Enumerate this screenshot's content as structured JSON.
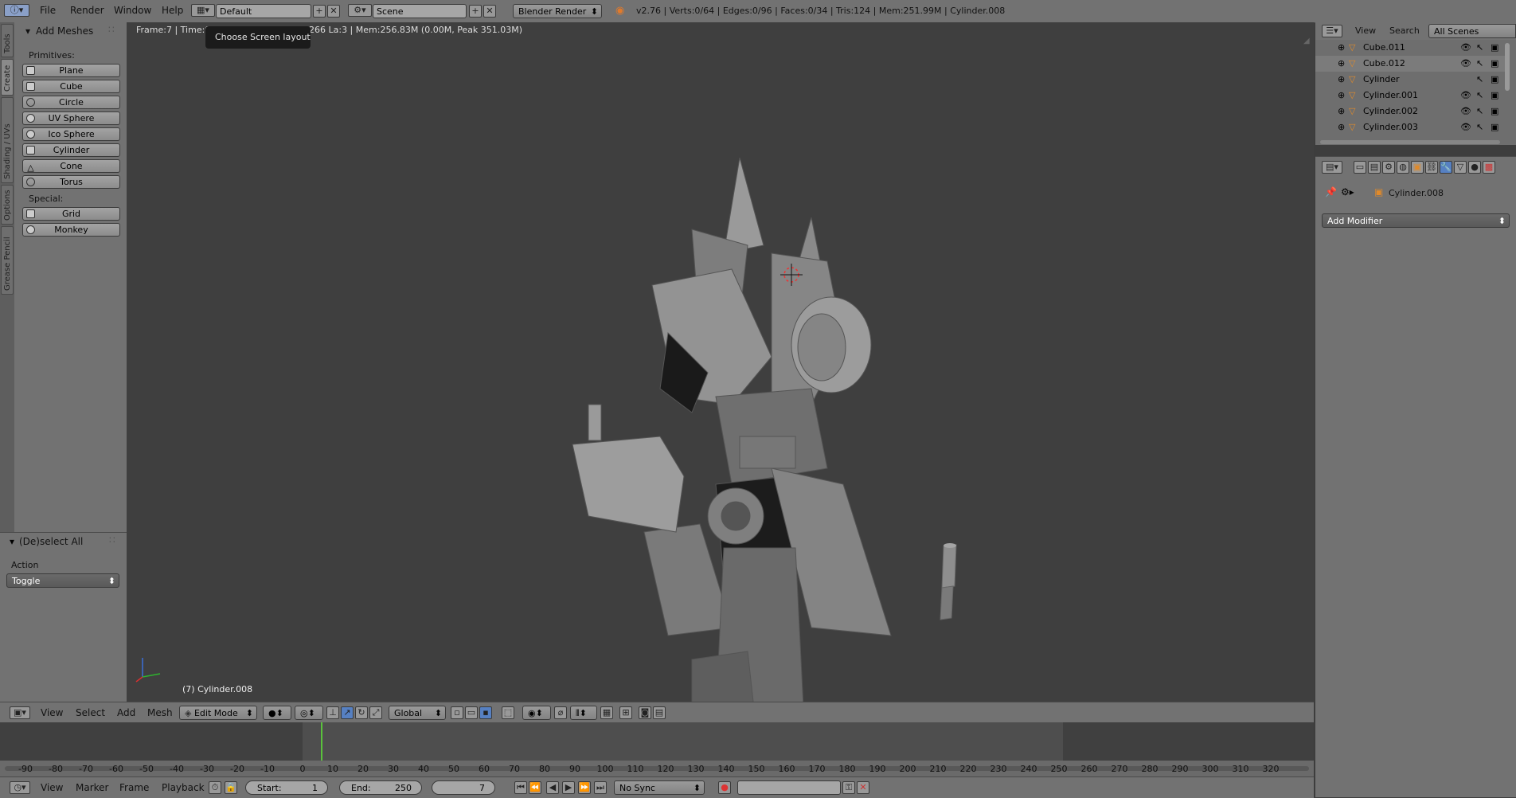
{
  "topbar": {
    "menus": [
      "File",
      "Render",
      "Window",
      "Help"
    ],
    "layout_name": "Default",
    "scene_name": "Scene",
    "engine": "Blender Render",
    "stats": "v2.76 | Verts:0/64 | Edges:0/96 | Faces:0/34 | Tris:124 | Mem:251.99M | Cylinder.008"
  },
  "tooltip": "Choose Screen layout",
  "viewport": {
    "info": "Frame:7 | Time:00",
    "info2": "2266 La:3 | Mem:256.83M (0.00M, Peak 351.03M)",
    "object_label": "(7) Cylinder.008"
  },
  "tabs": [
    "Tools",
    "Create",
    "Shading / UVs",
    "Options",
    "Grease Pencil"
  ],
  "add_meshes": {
    "title": "Add Meshes",
    "primitives_label": "Primitives:",
    "primitives": [
      "Plane",
      "Cube",
      "Circle",
      "UV Sphere",
      "Ico Sphere",
      "Cylinder",
      "Cone",
      "Torus"
    ],
    "special_label": "Special:",
    "special": [
      "Grid",
      "Monkey"
    ]
  },
  "redo": {
    "title": "(De)select All",
    "action_label": "Action",
    "action_value": "Toggle"
  },
  "vheader": {
    "menus": [
      "View",
      "Select",
      "Add",
      "Mesh"
    ],
    "mode": "Edit Mode",
    "orientation": "Global"
  },
  "timeline": {
    "ticks": [
      "-90",
      "-80",
      "-70",
      "-60",
      "-50",
      "-40",
      "-30",
      "-20",
      "-10",
      "0",
      "10",
      "20",
      "30",
      "40",
      "50",
      "60",
      "70",
      "80",
      "90",
      "100",
      "110",
      "120",
      "130",
      "140",
      "150",
      "160",
      "170",
      "180",
      "190",
      "200",
      "210",
      "220",
      "230",
      "240",
      "250",
      "260",
      "270",
      "280",
      "290",
      "300",
      "310",
      "320"
    ],
    "menus": [
      "View",
      "Marker",
      "Frame",
      "Playback"
    ],
    "start_label": "Start:",
    "start": "1",
    "end_label": "End:",
    "end": "250",
    "current": "7",
    "sync": "No Sync"
  },
  "outliner": {
    "menus": [
      "View",
      "Search"
    ],
    "scope": "All Scenes",
    "rows": [
      "Cube.011",
      "Cube.012",
      "Cylinder",
      "Cylinder.001",
      "Cylinder.002",
      "Cylinder.003"
    ]
  },
  "properties": {
    "object": "Cylinder.008",
    "add_modifier": "Add Modifier"
  },
  "colors": {
    "panel": "#727272",
    "viewport": "#3f3f3f",
    "tooltip": "#1b1b1b",
    "accent": "#5680c2",
    "playhead": "#5ac23c"
  }
}
